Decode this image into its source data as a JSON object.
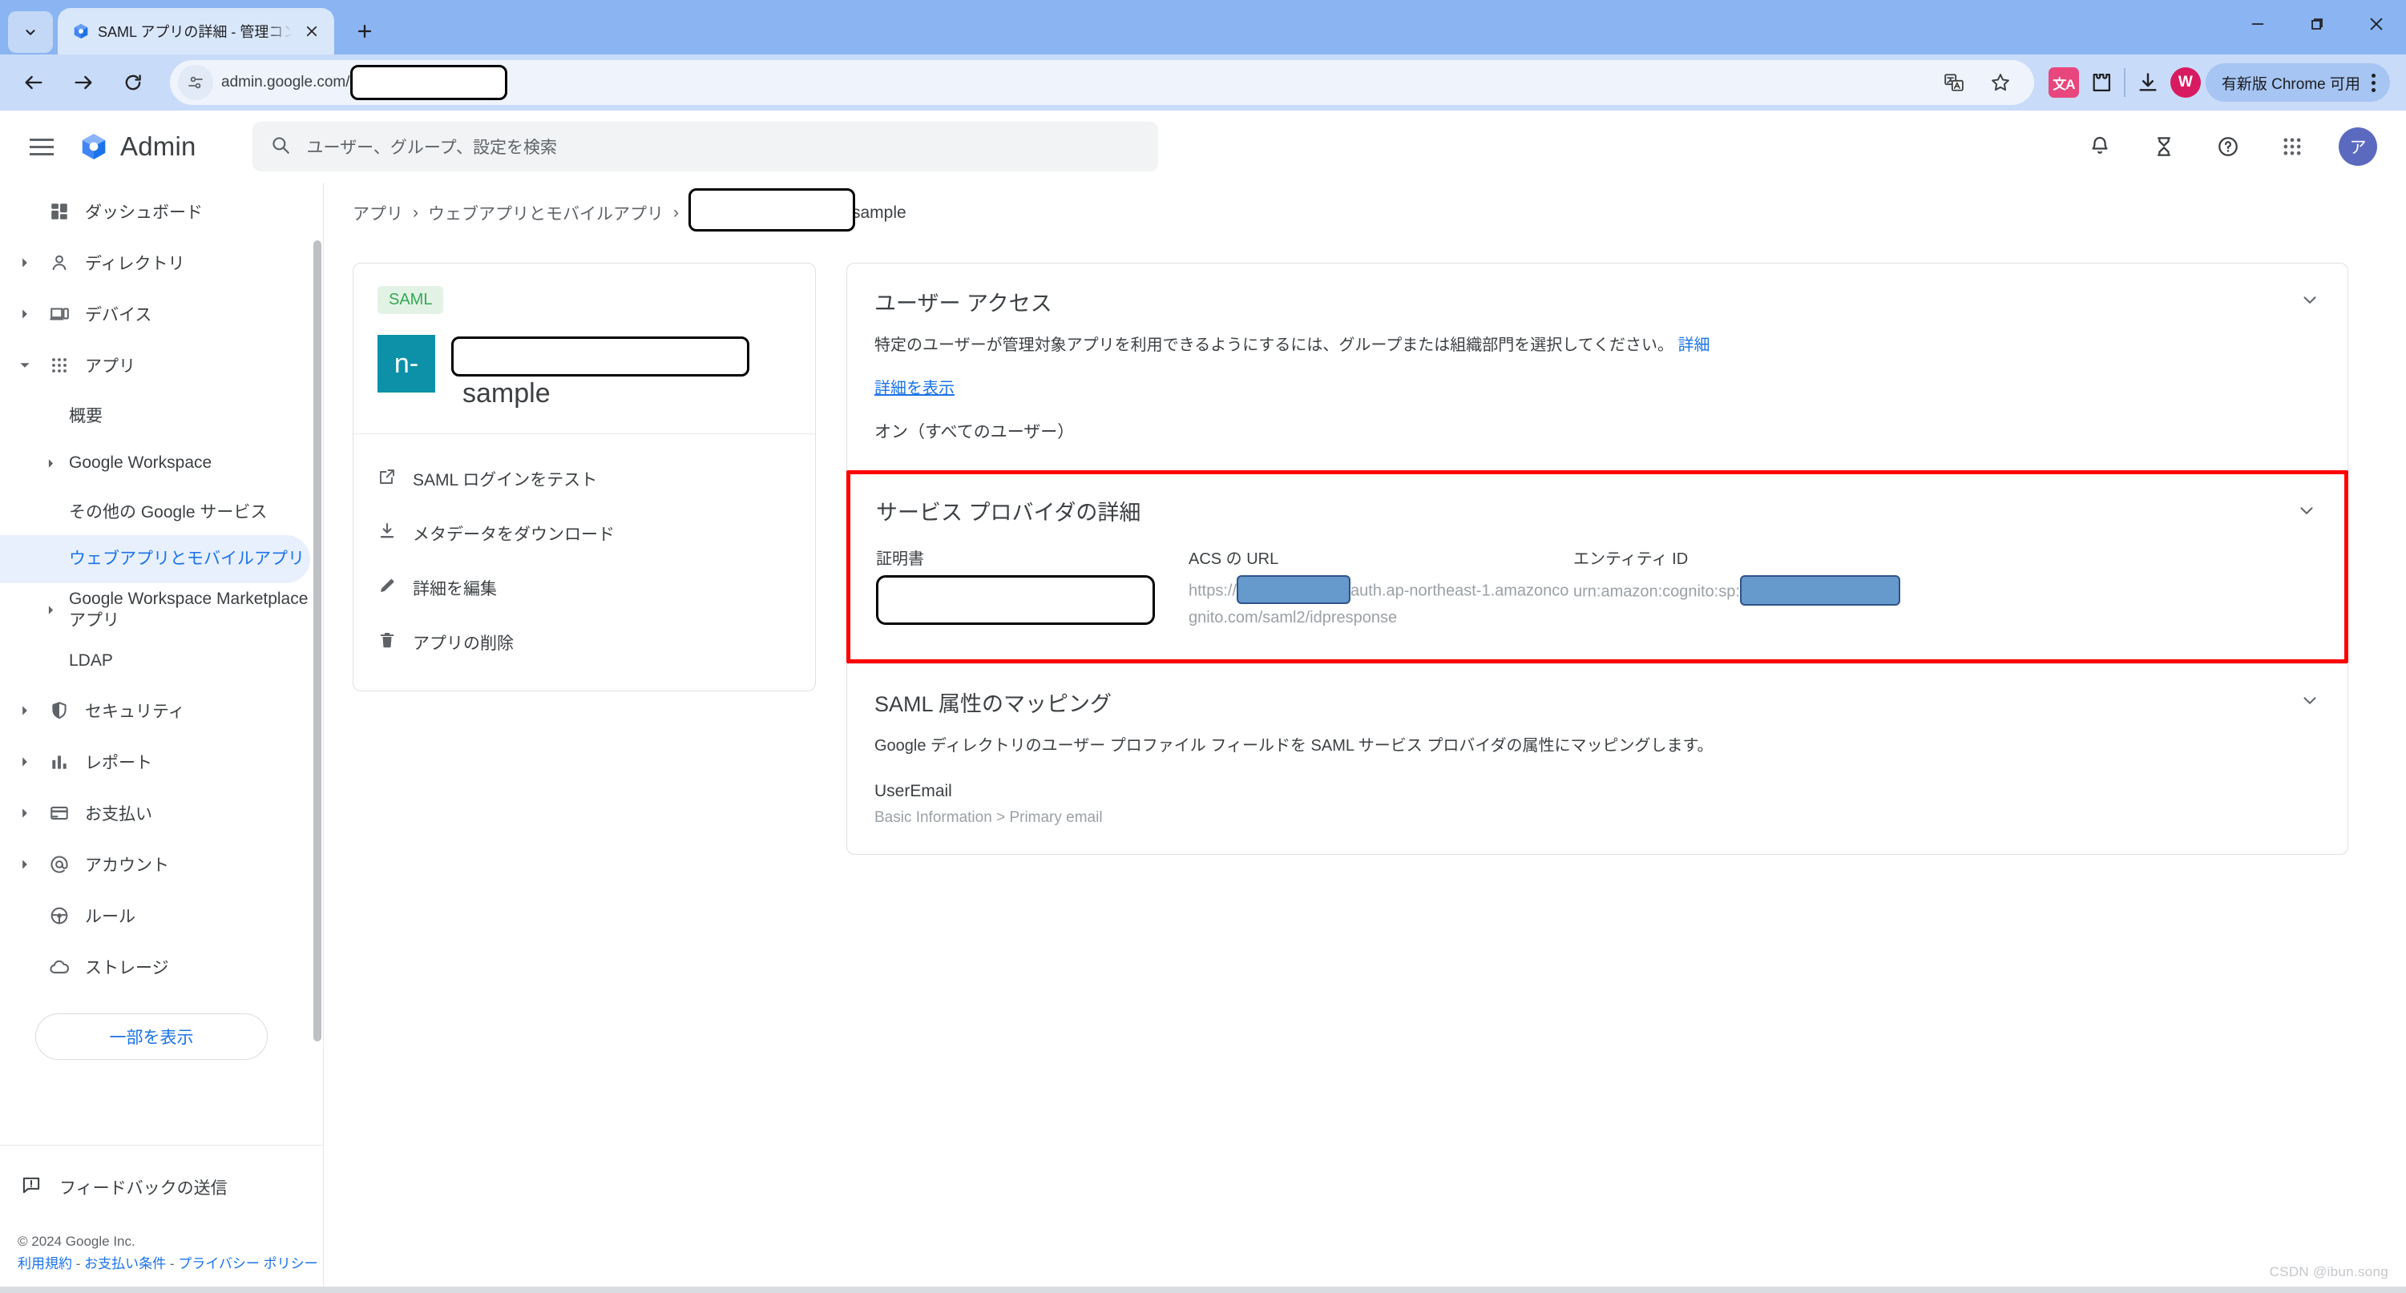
{
  "browser": {
    "tab": {
      "title": "SAML アプリの詳細 - 管理コンソ―",
      "favicon_name": "google-admin-favicon"
    },
    "newtab_label": "+",
    "omnibox": {
      "url_prefix": "admin.google.com/",
      "redacted": true
    },
    "update_button_label": "有新版 Chrome 可用",
    "profile_initial": "W"
  },
  "appbar": {
    "brand": "Admin",
    "search_placeholder": "ユーザー、グループ、設定を検索",
    "avatar_initial": "ア"
  },
  "nav": {
    "items": [
      {
        "label": "ダッシュボード",
        "icon": "dashboard-icon",
        "expandable": false
      },
      {
        "label": "ディレクトリ",
        "icon": "person-icon",
        "expandable": true
      },
      {
        "label": "デバイス",
        "icon": "device-icon",
        "expandable": true
      },
      {
        "label": "アプリ",
        "icon": "apps-grid-icon",
        "expandable": true,
        "expanded": true
      }
    ],
    "sub_items": [
      {
        "label": "概要",
        "expandable": false,
        "selected": false
      },
      {
        "label": "Google Workspace",
        "expandable": true,
        "selected": false
      },
      {
        "label": "その他の Google サービス",
        "expandable": false,
        "selected": false
      },
      {
        "label": "ウェブアプリとモバイルアプリ",
        "expandable": false,
        "selected": true
      },
      {
        "label": "Google Workspace Marketplace アプリ",
        "expandable": true,
        "selected": false
      },
      {
        "label": "LDAP",
        "expandable": false,
        "selected": false
      }
    ],
    "items_after": [
      {
        "label": "セキュリティ",
        "icon": "shield-icon",
        "expandable": true
      },
      {
        "label": "レポート",
        "icon": "bar-chart-icon",
        "expandable": true
      },
      {
        "label": "お支払い",
        "icon": "credit-card-icon",
        "expandable": true
      },
      {
        "label": "アカウント",
        "icon": "at-sign-icon",
        "expandable": true
      },
      {
        "label": "ルール",
        "icon": "steering-wheel-icon",
        "expandable": false
      },
      {
        "label": "ストレージ",
        "icon": "cloud-icon",
        "expandable": false
      }
    ],
    "show_some_label": "一部を表示",
    "feedback_label": "フィードバックの送信",
    "copyright": "© 2024 Google Inc.",
    "legal_terms": "利用規約",
    "legal_billing": "お支払い条件",
    "legal_privacy": "プライバシー ポリシー",
    "legal_sep": " - "
  },
  "breadcrumb": {
    "item1": "アプリ",
    "item2": "ウェブアプリとモバイルアプリ",
    "separator": "›",
    "item3_tail": "sample"
  },
  "app_card": {
    "badge": "SAML",
    "logo_text": "n-",
    "name_tail": "sample",
    "actions": [
      {
        "label": "SAML ログインをテスト",
        "icon": "external-link-icon"
      },
      {
        "label": "メタデータをダウンロード",
        "icon": "download-icon"
      },
      {
        "label": "詳細を編集",
        "icon": "pencil-icon"
      },
      {
        "label": "アプリの削除",
        "icon": "trash-icon"
      }
    ]
  },
  "user_access": {
    "title": "ユーザー アクセス",
    "description": "特定のユーザーが管理対象アプリを利用できるようにするには、グループまたは組織部門を選択してください。",
    "description_link": "詳細",
    "show_details_link": "詳細を表示",
    "status": "オン（すべてのユーザー）"
  },
  "service_provider": {
    "title": "サービス プロバイダの詳細",
    "highlight_color": "#ff0000",
    "fields": {
      "certificate_label": "証明書",
      "certificate_value_redacted": true,
      "acs_label": "ACS の URL",
      "acs_prefix": "https://",
      "acs_suffix": "auth.ap-northeast-1.amazoncognito.com/saml2/idpresponse",
      "entity_label": "エンティティ ID",
      "entity_prefix": "urn:amazon:cognito:sp:"
    }
  },
  "saml_mapping": {
    "title": "SAML 属性のマッピング",
    "description": "Google ディレクトリのユーザー プロファイル フィールドを SAML サービス プロバイダの属性にマッピングします。",
    "attribute_name": "UserEmail",
    "attribute_path": "Basic Information > Primary email"
  },
  "watermark": "CSDN @ibun.song"
}
